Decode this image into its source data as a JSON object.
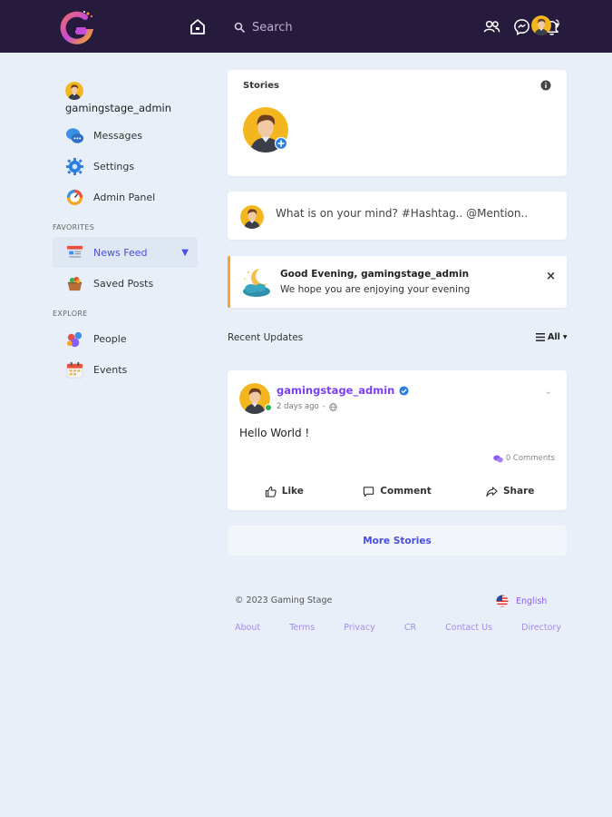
{
  "header": {
    "search_placeholder": "Search"
  },
  "sidebar": {
    "username": "gamingstage_admin",
    "items": [
      {
        "label": "Messages"
      },
      {
        "label": "Settings"
      },
      {
        "label": "Admin Panel"
      }
    ],
    "favorites_label": "FAVORITES",
    "favorites": [
      {
        "label": "News Feed",
        "active": true
      },
      {
        "label": "Saved Posts"
      }
    ],
    "explore_label": "EXPLORE",
    "explore": [
      {
        "label": "People"
      },
      {
        "label": "Events"
      }
    ]
  },
  "stories": {
    "title": "Stories"
  },
  "composer": {
    "placeholder": "What is on your mind? #Hashtag.. @Mention.."
  },
  "greeting": {
    "title": "Good Evening, gamingstage_admin",
    "subtitle": "We hope you are enjoying your evening"
  },
  "feed": {
    "recent_label": "Recent Updates",
    "filter_label": "All"
  },
  "post": {
    "author": "gamingstage_admin",
    "time": "2 days ago",
    "separator": "-",
    "body": "Hello World !",
    "comments": "0 Comments",
    "actions": {
      "like": "Like",
      "comment": "Comment",
      "share": "Share"
    }
  },
  "more_stories": "More Stories",
  "footer": {
    "copyright": "© 2023 Gaming Stage",
    "language": "English",
    "links": [
      "About",
      "Terms",
      "Privacy",
      "CR",
      "Contact Us",
      "Directory"
    ]
  },
  "colors": {
    "topbar": "#261a3d",
    "accent": "#4a4ee0",
    "author": "#7b3ff2",
    "greeting_border": "#f5a623"
  }
}
